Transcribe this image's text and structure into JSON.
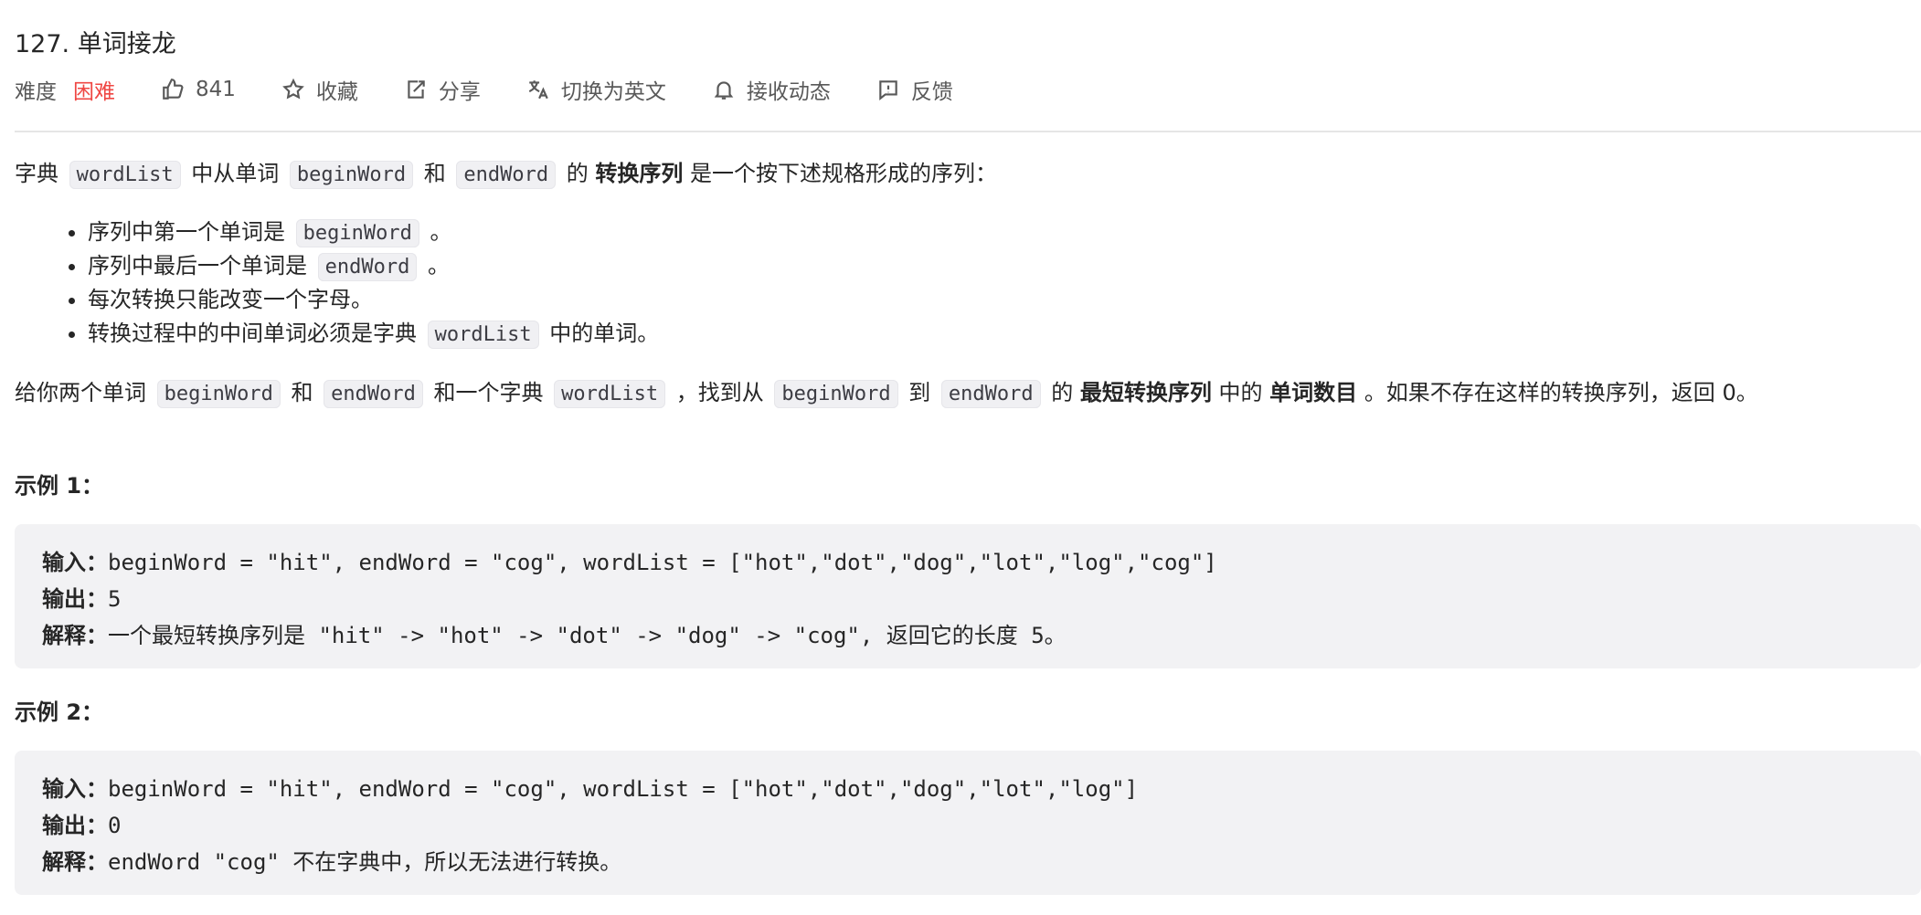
{
  "problem": {
    "title": "127. 单词接龙",
    "difficulty_label": "难度",
    "difficulty_value": "困难",
    "likes": "841",
    "favorite_label": "收藏",
    "share_label": "分享",
    "switch_lang_label": "切换为英文",
    "subscribe_label": "接收动态",
    "feedback_label": "反馈"
  },
  "description": {
    "intro": {
      "t1": "字典",
      "c1": "wordList",
      "t2": "中从单词",
      "c2": "beginWord",
      "t3": "和",
      "c3": "endWord",
      "t4": "的",
      "b1": "转换序列",
      "t5": "是一个按下述规格形成的序列："
    },
    "rules": [
      {
        "pre": "序列中第一个单词是",
        "code": "beginWord",
        "post": "。"
      },
      {
        "pre": "序列中最后一个单词是",
        "code": "endWord",
        "post": "。"
      },
      {
        "pre": "每次转换只能改变一个字母。"
      },
      {
        "pre": "转换过程中的中间单词必须是字典",
        "code": "wordList",
        "post": "中的单词。"
      }
    ],
    "task": {
      "t1": "给你两个单词",
      "c1": "beginWord",
      "t2": "和",
      "c2": "endWord",
      "t3": "和一个字典",
      "c3": "wordList",
      "t4": "，找到从",
      "c4": "beginWord",
      "t5": "到",
      "c5": "endWord",
      "t6": "的",
      "b1": "最短转换序列",
      "t7": "中的",
      "b2": "单词数目",
      "t8": "。如果不存在这样的转换序列，返回 0。"
    }
  },
  "examples": [
    {
      "title": "示例 1：",
      "input_label": "输入：",
      "input": "beginWord = \"hit\", endWord = \"cog\", wordList = [\"hot\",\"dot\",\"dog\",\"lot\",\"log\",\"cog\"]",
      "output_label": "输出：",
      "output": "5",
      "explain_label": "解释：",
      "explain": "一个最短转换序列是 \"hit\" -> \"hot\" -> \"dot\" -> \"dog\" -> \"cog\", 返回它的长度 5。"
    },
    {
      "title": "示例 2：",
      "input_label": "输入：",
      "input": "beginWord = \"hit\", endWord = \"cog\", wordList = [\"hot\",\"dot\",\"dog\",\"lot\",\"log\"]",
      "output_label": "输出：",
      "output": "0",
      "explain_label": "解释：",
      "explain": "endWord \"cog\" 不在字典中，所以无法进行转换。"
    }
  ],
  "colors": {
    "difficulty_hard": "#ef4743",
    "code_bg": "#f0f0f3",
    "example_bg": "#f2f2f4"
  }
}
